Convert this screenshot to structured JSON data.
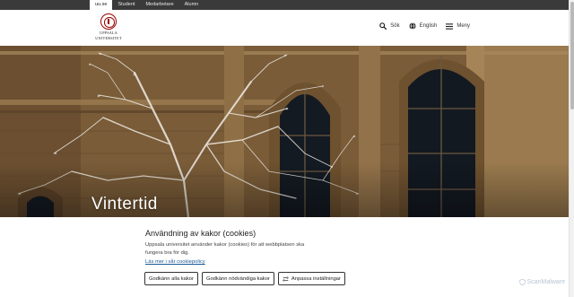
{
  "audience_tabs": [
    {
      "label": "uu.se",
      "active": true
    },
    {
      "label": "Student",
      "active": false
    },
    {
      "label": "Medarbetare",
      "active": false
    },
    {
      "label": "Alumn",
      "active": false
    }
  ],
  "logo": {
    "line1": "UPPSALA",
    "line2": "UNIVERSITET",
    "color": "#990000"
  },
  "header": {
    "search_label": "Sök",
    "search_icon": "search-icon",
    "language_label": "English",
    "language_icon": "globe-icon",
    "menu_label": "Meny",
    "menu_icon": "hamburger-icon"
  },
  "hero": {
    "title": "Vintertid"
  },
  "cookie": {
    "title": "Användning av kakor (cookies)",
    "text": "Uppsala universitet använder kakor (cookies) för att webbplatsen ska fungera bra för dig.",
    "link": "Läs mer i vår cookiepolicy",
    "btn_accept_all": "Godkänn alla kakor",
    "btn_accept_necessary": "Godkänn nödvändiga kakor",
    "btn_customize": "Anpassa inställningar",
    "customize_icon": "sliders-icon"
  },
  "watermark": "ScanMalware"
}
